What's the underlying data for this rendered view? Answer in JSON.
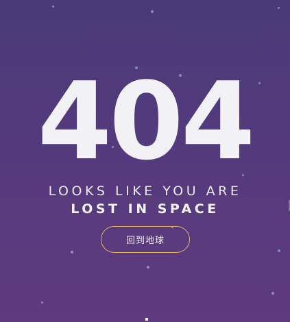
{
  "error_code": "404",
  "message": {
    "line1": "LOOKS LIKE YOU ARE",
    "line2": "LOST IN SPACE"
  },
  "home_button": {
    "label": "回到地球"
  },
  "colors": {
    "background_top": "#4b3a78",
    "background_bottom": "#5f3a7c",
    "text": "#f2f1f5",
    "button_border": "#e7b55a"
  }
}
